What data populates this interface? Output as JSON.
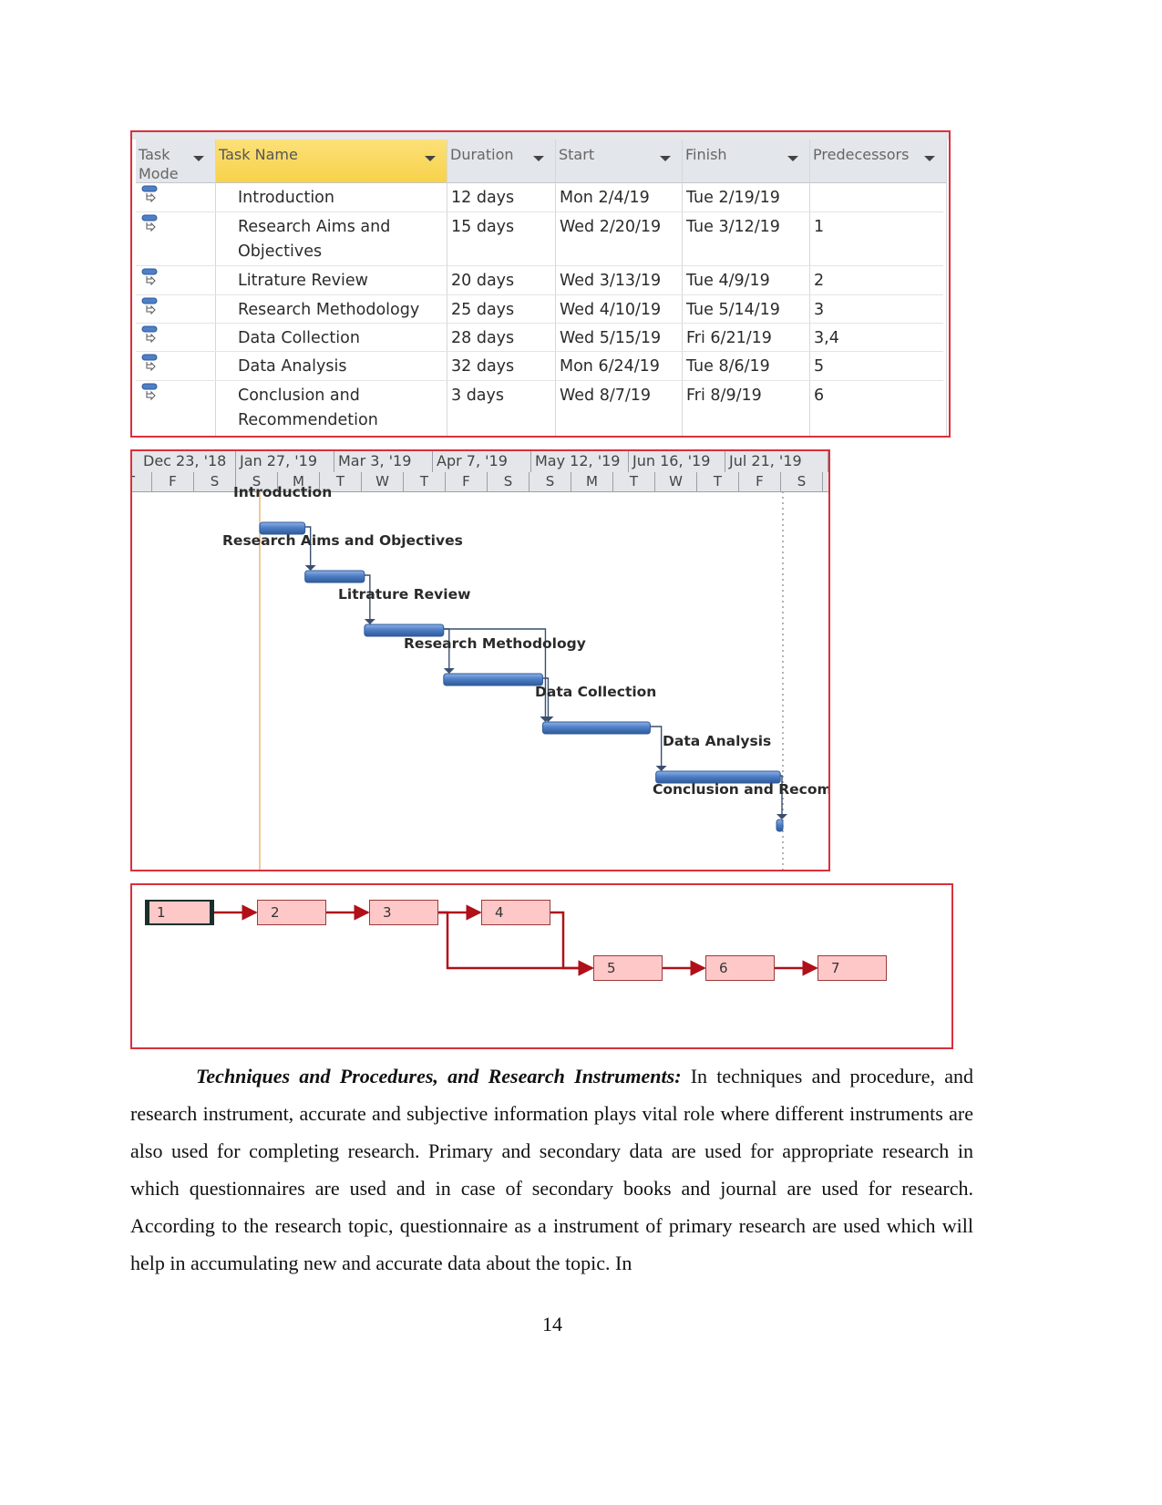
{
  "task_table": {
    "columns": [
      {
        "key": "mode",
        "label": "Task Mode"
      },
      {
        "key": "name",
        "label": "Task Name"
      },
      {
        "key": "duration",
        "label": "Duration"
      },
      {
        "key": "start",
        "label": "Start"
      },
      {
        "key": "finish",
        "label": "Finish"
      },
      {
        "key": "pred",
        "label": "Predecessors"
      }
    ],
    "header": {
      "mode_line1": "Task",
      "mode_line2": "Mode",
      "name": "Task Name",
      "duration": "Duration",
      "start": "Start",
      "finish": "Finish",
      "pred": "Predecessors"
    },
    "rows": [
      {
        "id": 1,
        "name_line1": "Introduction",
        "name_line2": "",
        "duration": "12 days",
        "start": "Mon 2/4/19",
        "finish": "Tue 2/19/19",
        "pred": "",
        "mode_icon": "auto-scheduled-task-icon"
      },
      {
        "id": 2,
        "name_line1": "Research Aims and",
        "name_line2": "Objectives",
        "duration": "15 days",
        "start": "Wed 2/20/19",
        "finish": "Tue 3/12/19",
        "pred": "1",
        "mode_icon": "auto-scheduled-task-icon"
      },
      {
        "id": 3,
        "name_line1": "Litrature Review",
        "name_line2": "",
        "duration": "20 days",
        "start": "Wed 3/13/19",
        "finish": "Tue 4/9/19",
        "pred": "2",
        "mode_icon": "auto-scheduled-task-icon"
      },
      {
        "id": 4,
        "name_line1": "Research Methodology",
        "name_line2": "",
        "duration": "25 days",
        "start": "Wed 4/10/19",
        "finish": "Tue 5/14/19",
        "pred": "3",
        "mode_icon": "auto-scheduled-task-icon"
      },
      {
        "id": 5,
        "name_line1": "Data Collection",
        "name_line2": "",
        "duration": "28 days",
        "start": "Wed 5/15/19",
        "finish": "Fri 6/21/19",
        "pred": "3,4",
        "mode_icon": "auto-scheduled-task-icon"
      },
      {
        "id": 6,
        "name_line1": "Data Analysis",
        "name_line2": "",
        "duration": "32 days",
        "start": "Mon 6/24/19",
        "finish": "Tue 8/6/19",
        "pred": "5",
        "mode_icon": "auto-scheduled-task-icon"
      },
      {
        "id": 7,
        "name_line1": "Conclusion and",
        "name_line2": "Recommendetion",
        "duration": "3 days",
        "start": "Wed 8/7/19",
        "finish": "Fri 8/9/19",
        "pred": "6",
        "mode_icon": "auto-scheduled-task-icon"
      }
    ]
  },
  "gantt": {
    "major_scale": [
      "Dec 23, '18",
      "Jan 27, '19",
      "Mar 3, '19",
      "Apr 7, '19",
      "May 12, '19",
      "Jun 16, '19",
      "Jul 21, '19"
    ],
    "minor_scale": [
      "T",
      "F",
      "S",
      "S",
      "M",
      "T",
      "W",
      "T",
      "F",
      "S",
      "S",
      "M",
      "T",
      "W",
      "T",
      "F",
      "S"
    ],
    "bar_labels": [
      "Introduction",
      "Research Aims and Objectives",
      "Litrature Review",
      "Research Methodology",
      "Data Collection",
      "Data Analysis",
      "Conclusion and Recomn"
    ],
    "colors": {
      "bar": "#4f7fc7",
      "bar_dark": "#2f5a98",
      "link": "#3a4f6e",
      "today_line": "#f2c9a0"
    }
  },
  "network": {
    "nodes": [
      "1",
      "2",
      "3",
      "4",
      "5",
      "6",
      "7"
    ],
    "links": [
      [
        1,
        2
      ],
      [
        2,
        3
      ],
      [
        3,
        4
      ],
      [
        3,
        5
      ],
      [
        4,
        5
      ],
      [
        5,
        6
      ],
      [
        6,
        7
      ]
    ],
    "colors": {
      "node_fill": "#ffc8c8",
      "node_border": "#9b3a3a",
      "link": "#b0101a",
      "selected_border": "#1c2e2b"
    }
  },
  "body": {
    "heading": "Techniques and Procedures, and Research Instruments:",
    "text": " In techniques and procedure, and research instrument, accurate and subjective information plays vital role where different instruments are also used for completing research.  Primary and secondary data are used for appropriate research in which questionnaires are used and in case of secondary books and journal are used for research. According to the research topic, questionnaire as a instrument of primary research are used which will help in accumulating new and accurate data about the topic. In"
  },
  "page_number": "14",
  "colors": {
    "frame": "#d9303a",
    "header_selected": "#f7d24a"
  }
}
